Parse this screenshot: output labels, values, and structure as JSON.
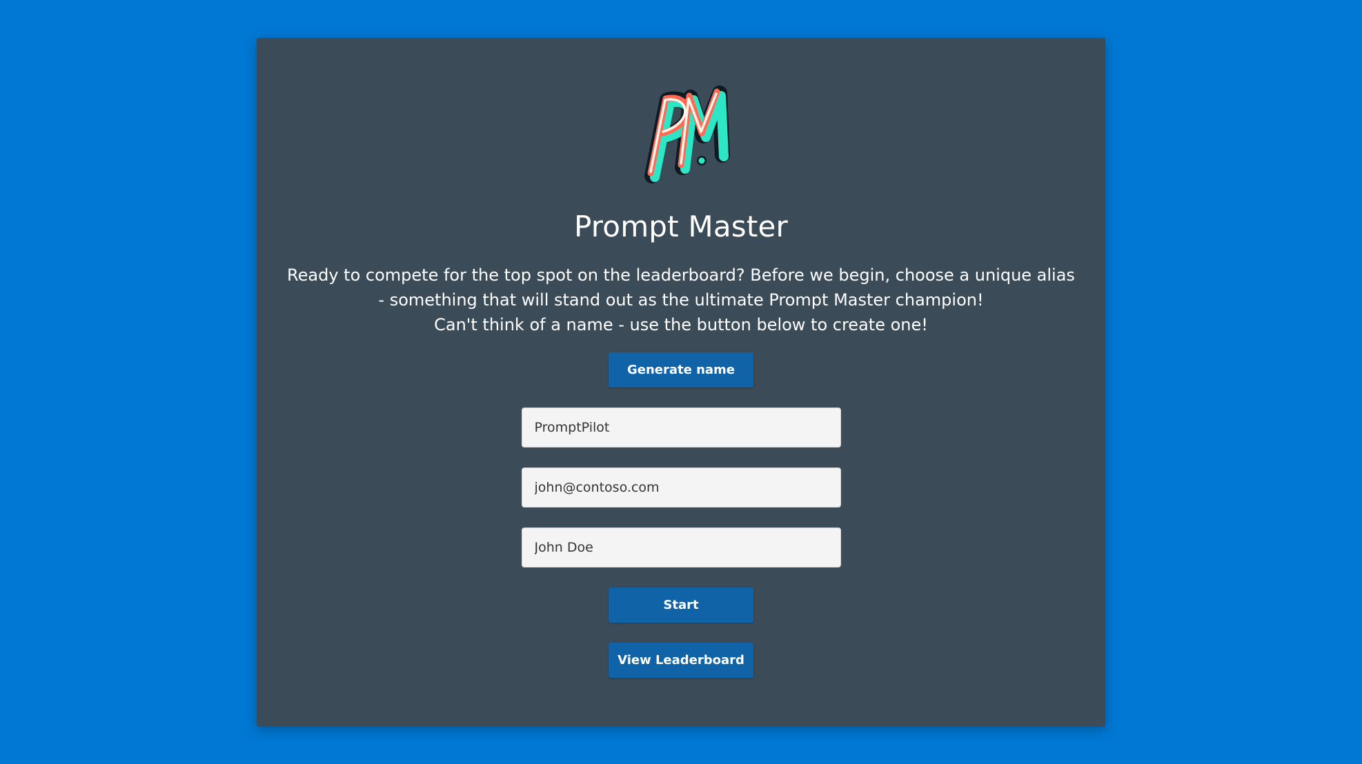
{
  "app": {
    "title": "Prompt Master",
    "logo_text": "PM"
  },
  "intro": {
    "line1": "Ready to compete for the top spot on the leaderboard? Before we begin, choose a unique alias - something that will stand out as the ultimate Prompt Master champion!",
    "line2": "Can't think of a name - use the button below to create one!"
  },
  "buttons": {
    "generate_label": "Generate name",
    "start_label": "Start",
    "leaderboard_label": "View Leaderboard"
  },
  "form": {
    "alias": {
      "value": "PromptPilot"
    },
    "email": {
      "value": "john@contoso.com"
    },
    "name": {
      "value": "John Doe"
    }
  },
  "colors": {
    "page_background": "#0078d4",
    "card_background": "#3c4b58",
    "button_background": "#1063a6",
    "field_background": "#f4f4f4",
    "logo_coral": "#ff6a55",
    "logo_teal": "#2ee6c5"
  }
}
